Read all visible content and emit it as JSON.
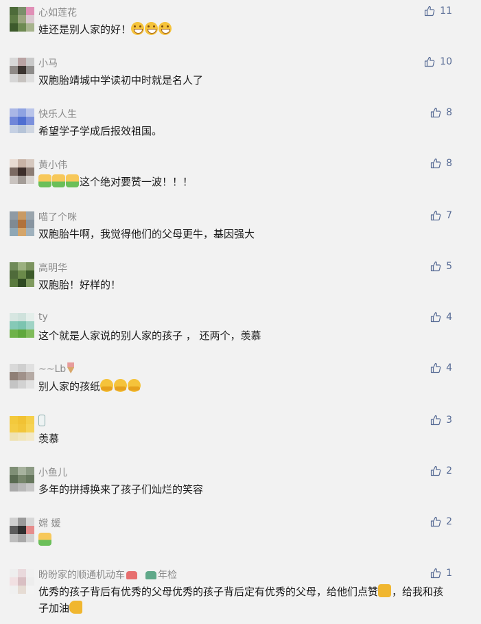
{
  "like_icon": "thumbs-up-outline-icon",
  "like_color": "#576b95",
  "comments": [
    {
      "name": "心如莲花",
      "text": "娃还是别人家的好！",
      "emojis_after": [
        "grin",
        "grin",
        "grin"
      ],
      "likes": "11",
      "avatar": [
        "#4d6b3a",
        "#7a8f6a",
        "#e08fb6",
        "#5c7a44",
        "#9aa57f",
        "#d9c8cf",
        "#3d5a2c",
        "#6e8a52",
        "#a7b48d"
      ]
    },
    {
      "name": "小马",
      "text": "双胞胎靖城中学读初中时就是名人了",
      "likes": "10",
      "avatar": [
        "#d8d8d8",
        "#b9a3a3",
        "#c9c9c9",
        "#8f8a87",
        "#3b3430",
        "#8e8c8a",
        "#d6d6d6",
        "#c6c2bf",
        "#dedede"
      ]
    },
    {
      "name": "快乐人生",
      "text": "希望学子学成后报效祖国。",
      "likes": "8",
      "avatar": [
        "#a9b6e6",
        "#8fa3e2",
        "#b9c4ea",
        "#6f86d9",
        "#4f6fd1",
        "#7b90dc",
        "#c5d0e3",
        "#b6c4d8",
        "#cfd6e1"
      ]
    },
    {
      "name": "黄小伟",
      "text": "这个绝对要赞一波！！！",
      "emojis_before": [
        "thumb",
        "thumb",
        "thumb"
      ],
      "likes": "8",
      "avatar": [
        "#e9dcd3",
        "#c8b3a6",
        "#d6c8bf",
        "#7b6a62",
        "#3c2e2a",
        "#8c7c74",
        "#c9c3bf",
        "#a39c97",
        "#d8d3cf"
      ]
    },
    {
      "name": "喵了个咪",
      "text": "双胞胎牛啊，我觉得他们的父母更牛，基因强大",
      "likes": "7",
      "avatar": [
        "#8f9aa4",
        "#c89a64",
        "#9aa5ad",
        "#7f8a93",
        "#b0723c",
        "#8794a0",
        "#8fa7b5",
        "#d4a56a",
        "#9fb1bd"
      ]
    },
    {
      "name": "高明华",
      "text": "双胞胎！好样的！",
      "likes": "5",
      "avatar": [
        "#6f8a58",
        "#9bb07f",
        "#7c945f",
        "#4f6b3a",
        "#6b8a4a",
        "#3c5a2a",
        "#5a7a3e",
        "#2f4a22",
        "#7f9a5e"
      ]
    },
    {
      "name": "ty",
      "text": "这个就是人家说的别人家的孩子 ， 还两个，羡慕",
      "likes": "4",
      "avatar": [
        "#d7e6e1",
        "#cfe2dc",
        "#e4eeea",
        "#86c9b7",
        "#7cc4b0",
        "#9fd3c5",
        "#6fb24a",
        "#5fa83c",
        "#7fbb5a"
      ]
    },
    {
      "name": "~~Lb",
      "name_icon": "icecream-icon",
      "text": "别人家的孩纸",
      "emojis_after": [
        "hug",
        "hug",
        "hug"
      ],
      "likes": "4",
      "avatar": [
        "#d9d9d9",
        "#cfcfcf",
        "#e0e0e0",
        "#8f7f76",
        "#a0918a",
        "#b5aaa4",
        "#c4c4c4",
        "#d2d2d2",
        "#e2e2e2"
      ]
    },
    {
      "name": "",
      "name_icon": "bottle-icon",
      "text": "羡慕",
      "likes": "3",
      "avatar": [
        "#f3c93c",
        "#f1c234",
        "#f5cf4a",
        "#f4cc44",
        "#f2c63b",
        "#f6d355",
        "#efe2b2",
        "#f1e6bd",
        "#f3e9c8"
      ]
    },
    {
      "name": "小鱼儿",
      "text": "多年的拼搏换来了孩子们灿烂的笑容",
      "likes": "2",
      "avatar": [
        "#7f8f76",
        "#a7b29e",
        "#8c9a84",
        "#5a6b52",
        "#77866c",
        "#66775d",
        "#a9a9a9",
        "#b8b8b8",
        "#c7c7c7"
      ]
    },
    {
      "name": "嫦 媛",
      "text": "",
      "emojis_after": [
        "thumb"
      ],
      "likes": "2",
      "avatar": [
        "#cfcfcf",
        "#9a9a9a",
        "#d7d7d7",
        "#5c5c5c",
        "#2f2f2f",
        "#e58c8c",
        "#bdbdbd",
        "#a8a8a8",
        "#d0d0d0"
      ]
    },
    {
      "name": "盼盼家的顺通机动车",
      "name_suffix": "年检",
      "text": "优秀的孩子背后有优秀的父母优秀的孩子背后定有优秀的父母，给他们点赞",
      "text2": "，给我和孩子加油",
      "likes": "1",
      "avatar": [
        "#eeeeee",
        "#e9d9dc",
        "#f0f0f0",
        "#f1e0e2",
        "#d9bfc3",
        "#ededed",
        "#f0f0f0",
        "#e6dcd4",
        "#f3f3f3"
      ]
    }
  ]
}
